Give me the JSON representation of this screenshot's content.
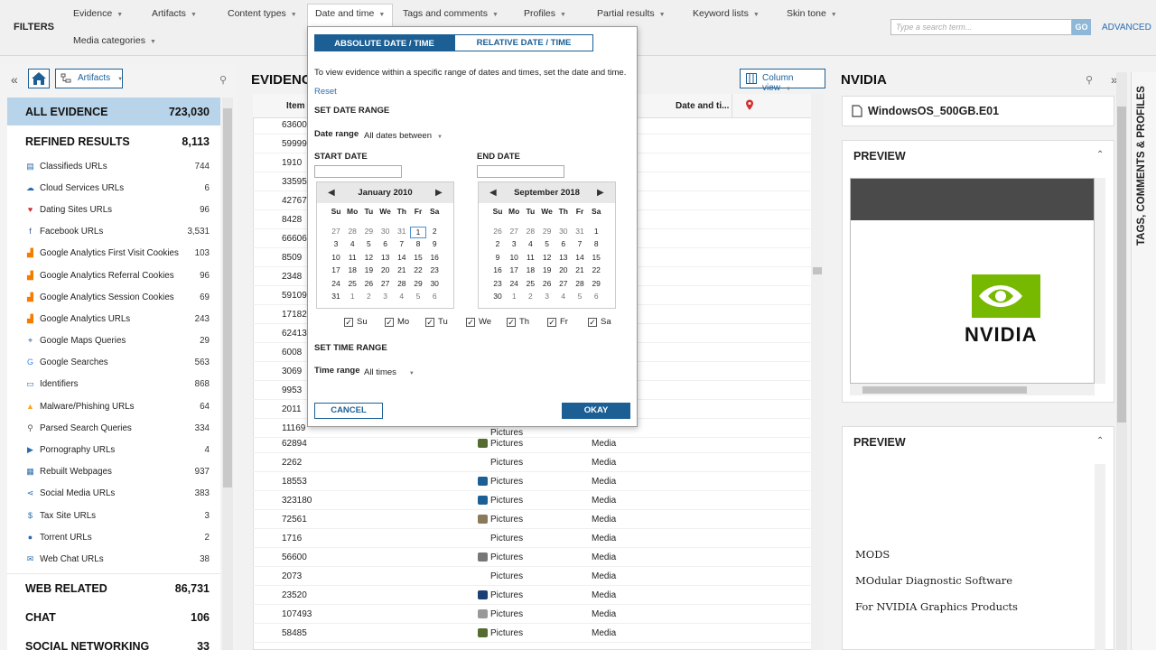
{
  "filters": {
    "title": "FILTERS",
    "menus": [
      "Evidence",
      "Artifacts",
      "Content types",
      "Date and time",
      "Tags and comments",
      "Profiles",
      "Partial results",
      "Keyword lists",
      "Skin tone",
      "Media categories"
    ],
    "search_placeholder": "Type a search term...",
    "go": "GO",
    "advanced": "ADVANCED"
  },
  "left": {
    "dropdown": "Artifacts",
    "all_label": "ALL EVIDENCE",
    "all_count": "723,030",
    "refined_label": "REFINED RESULTS",
    "refined_count": "8,113",
    "items": [
      {
        "name": "Classifieds URLs",
        "count": "744",
        "icon": "list-icon",
        "color": "#2b6cb0"
      },
      {
        "name": "Cloud Services URLs",
        "count": "6",
        "icon": "cloud-icon",
        "color": "#2b6cb0"
      },
      {
        "name": "Dating Sites URLs",
        "count": "96",
        "icon": "heart-icon",
        "color": "#d32f2f"
      },
      {
        "name": "Facebook URLs",
        "count": "3,531",
        "icon": "facebook-icon",
        "color": "#3b5998"
      },
      {
        "name": "Google Analytics First Visit Cookies",
        "count": "103",
        "icon": "analytics-icon",
        "color": "#f57c00"
      },
      {
        "name": "Google Analytics Referral Cookies",
        "count": "96",
        "icon": "analytics-icon",
        "color": "#f57c00"
      },
      {
        "name": "Google Analytics Session Cookies",
        "count": "69",
        "icon": "analytics-icon",
        "color": "#f57c00"
      },
      {
        "name": "Google Analytics URLs",
        "count": "243",
        "icon": "analytics-icon",
        "color": "#f57c00"
      },
      {
        "name": "Google Maps Queries",
        "count": "29",
        "icon": "map-pin-icon",
        "color": "#2b6cb0"
      },
      {
        "name": "Google Searches",
        "count": "563",
        "icon": "google-icon",
        "color": "#4285f4"
      },
      {
        "name": "Identifiers",
        "count": "868",
        "icon": "id-card-icon",
        "color": "#2b6cb0"
      },
      {
        "name": "Malware/Phishing URLs",
        "count": "64",
        "icon": "warning-icon",
        "color": "#f9a825"
      },
      {
        "name": "Parsed Search Queries",
        "count": "334",
        "icon": "search-icon",
        "color": "#555"
      },
      {
        "name": "Pornography URLs",
        "count": "4",
        "icon": "play-icon",
        "color": "#2b6cb0"
      },
      {
        "name": "Rebuilt Webpages",
        "count": "937",
        "icon": "web-icon",
        "color": "#2b6cb0"
      },
      {
        "name": "Social Media URLs",
        "count": "383",
        "icon": "share-icon",
        "color": "#2b6cb0"
      },
      {
        "name": "Tax Site URLs",
        "count": "3",
        "icon": "dollar-icon",
        "color": "#2b6cb0"
      },
      {
        "name": "Torrent URLs",
        "count": "2",
        "icon": "torrent-icon",
        "color": "#2b6cb0"
      },
      {
        "name": "Web Chat URLs",
        "count": "38",
        "icon": "chat-icon",
        "color": "#2b6cb0"
      }
    ],
    "groups": [
      {
        "name": "WEB RELATED",
        "count": "86,731"
      },
      {
        "name": "CHAT",
        "count": "106"
      },
      {
        "name": "SOCIAL NETWORKING",
        "count": "33"
      }
    ]
  },
  "center": {
    "title": "EVIDENCE",
    "column_view": "Column view",
    "col_item": "Item",
    "col_date": "Date and ti...",
    "rows_ids": [
      "63600",
      "59999",
      "1910",
      "33595",
      "42767",
      "8428",
      "66606",
      "8509",
      "2348",
      "59109",
      "17182",
      "62413",
      "6008",
      "3069",
      "9953",
      "2011",
      "11169"
    ],
    "rows": [
      {
        "id": "62894",
        "type": "Pictures",
        "cat": "Media",
        "color": "#556b2f"
      },
      {
        "id": "2262",
        "type": "Pictures",
        "cat": "Media",
        "color": ""
      },
      {
        "id": "18553",
        "type": "Pictures",
        "cat": "Media",
        "color": "#1c5f95"
      },
      {
        "id": "323180",
        "type": "Pictures",
        "cat": "Media",
        "color": "#1c5f95"
      },
      {
        "id": "72561",
        "type": "Pictures",
        "cat": "Media",
        "color": "#8a7a5a"
      },
      {
        "id": "1716",
        "type": "Pictures",
        "cat": "Media",
        "color": ""
      },
      {
        "id": "56600",
        "type": "Pictures",
        "cat": "Media",
        "color": "#777"
      },
      {
        "id": "2073",
        "type": "Pictures",
        "cat": "Media",
        "color": ""
      },
      {
        "id": "23520",
        "type": "Pictures",
        "cat": "Media",
        "color": "#1c3f75"
      },
      {
        "id": "107493",
        "type": "Pictures",
        "cat": "Media",
        "color": "#999"
      },
      {
        "id": "58485",
        "type": "Pictures",
        "cat": "Media",
        "color": "#556b2f"
      }
    ],
    "partial_row_type": "Pictures"
  },
  "right": {
    "title": "NVIDIA",
    "source": "WindowsOS_500GB.E01",
    "preview1": "PREVIEW",
    "preview2": "PREVIEW",
    "logo_text": "NVIDIA",
    "text_lines": [
      "MODS",
      "MOdular Diagnostic Software",
      "For NVIDIA Graphics Products"
    ],
    "side_tab": "TAGS, COMMENTS & PROFILES"
  },
  "popup": {
    "tab_abs": "ABSOLUTE DATE / TIME",
    "tab_rel": "RELATIVE DATE / TIME",
    "instructions": "To view evidence within a specific range of dates and times, set the date and time.",
    "reset": "Reset",
    "set_date_range": "SET DATE RANGE",
    "date_range_label": "Date range",
    "date_range_value": "All dates between",
    "start_date": "START DATE",
    "end_date": "END DATE",
    "cal1_month": "January 2010",
    "cal2_month": "September 2018",
    "dow": [
      "Su",
      "Mo",
      "Tu",
      "We",
      "Th",
      "Fr",
      "Sa"
    ],
    "cal1_days": [
      "27",
      "28",
      "29",
      "30",
      "31",
      "1",
      "2",
      "3",
      "4",
      "5",
      "6",
      "7",
      "8",
      "9",
      "10",
      "11",
      "12",
      "13",
      "14",
      "15",
      "16",
      "17",
      "18",
      "19",
      "20",
      "21",
      "22",
      "23",
      "24",
      "25",
      "26",
      "27",
      "28",
      "29",
      "30",
      "31",
      "1",
      "2",
      "3",
      "4",
      "5",
      "6"
    ],
    "cal2_days": [
      "26",
      "27",
      "28",
      "29",
      "30",
      "31",
      "1",
      "2",
      "3",
      "4",
      "5",
      "6",
      "7",
      "8",
      "9",
      "10",
      "11",
      "12",
      "13",
      "14",
      "15",
      "16",
      "17",
      "18",
      "19",
      "20",
      "21",
      "22",
      "23",
      "24",
      "25",
      "26",
      "27",
      "28",
      "29",
      "30",
      "1",
      "2",
      "3",
      "4",
      "5",
      "6"
    ],
    "weekday_checks": [
      "Su",
      "Mo",
      "Tu",
      "We",
      "Th",
      "Fr",
      "Sa"
    ],
    "set_time_range": "SET TIME RANGE",
    "time_range_label": "Time range",
    "time_range_value": "All times",
    "cancel": "CANCEL",
    "okay": "OKAY"
  }
}
